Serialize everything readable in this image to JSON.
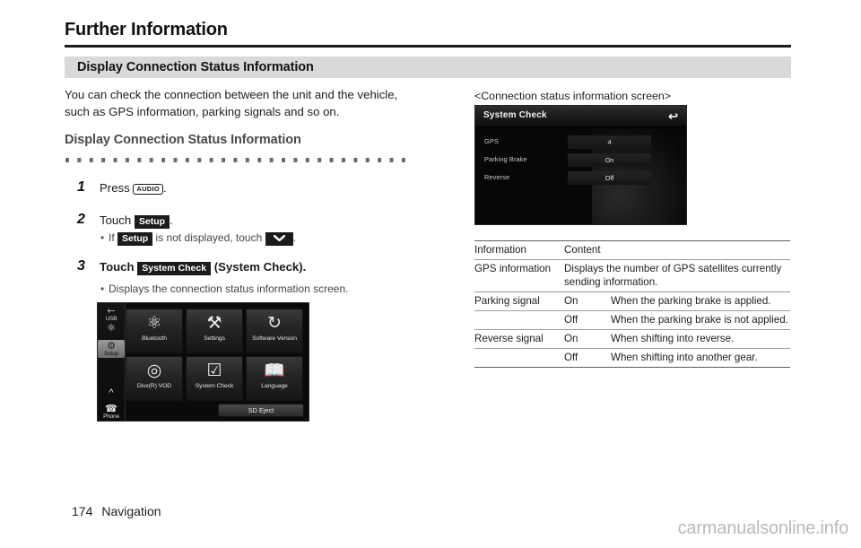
{
  "page": {
    "title": "Further Information",
    "section_band": "Display Connection Status Information",
    "footer_page_number": "174",
    "footer_section": "Navigation",
    "watermark": "carmanualsonline.info"
  },
  "left": {
    "intro": "You can check the connection between the unit and the vehicle, such as GPS information, parking signals and so on.",
    "subsection_title": "Display Connection Status Information",
    "steps": [
      {
        "number": "1",
        "prefix": "Press ",
        "chip": "AUDIO",
        "chip_type": "key",
        "suffix": ".",
        "substeps": []
      },
      {
        "number": "2",
        "prefix": "Touch ",
        "chip": "Setup",
        "chip_type": "touch",
        "suffix": ".",
        "substeps": [
          {
            "pre": "If ",
            "chip": "Setup",
            "mid": " is not displayed, touch ",
            "chip2": "⌄",
            "post": "."
          }
        ]
      },
      {
        "number": "3",
        "prefix": "Touch ",
        "chip": "System Check",
        "chip_type": "touch",
        "suffix": " (System Check).",
        "substeps": [
          {
            "pre": "Displays the connection status information screen.",
            "chip": "",
            "mid": "",
            "chip2": "",
            "post": ""
          }
        ]
      }
    ]
  },
  "device_screen": {
    "sidebar": [
      {
        "icon": "usb-icon",
        "glyph": "⌁",
        "label": "USB"
      },
      {
        "icon": "bluetooth-icon",
        "glyph": "Ƀ",
        "label": ""
      },
      {
        "icon": "setup-gear-icon",
        "glyph": "⚙",
        "label": "Setup"
      },
      {
        "icon": "chevron-up-icon",
        "glyph": "⌃",
        "label": ""
      },
      {
        "icon": "phone-icon",
        "glyph": "☎",
        "label": "Phone"
      }
    ],
    "tiles": [
      {
        "icon": "bluetooth-icon",
        "glyph": "Ƀ",
        "label": "Bluetooth"
      },
      {
        "icon": "settings-gear-wrench-icon",
        "glyph": "⚒",
        "label": "Settings"
      },
      {
        "icon": "refresh-circular-arrow-icon",
        "glyph": "↻",
        "label": "Software Version"
      },
      {
        "icon": "disc-icon",
        "glyph": "◎",
        "label": "Divx(R) VOD"
      },
      {
        "icon": "checklist-clipboard-icon",
        "glyph": "☑",
        "label": "System Check"
      },
      {
        "icon": "open-book-icon",
        "glyph": "☷",
        "label": "Language"
      }
    ],
    "sd_eject_label": "SD Eject"
  },
  "right": {
    "caption": "<Connection status information screen>",
    "system_check_screen": {
      "header_title": "System Check",
      "back_icon": "back-arrow-icon",
      "rows": [
        {
          "label": "GPS",
          "value": "4"
        },
        {
          "label": "Parking Brake",
          "value": "On"
        },
        {
          "label": "Reverse",
          "value": "Off"
        }
      ]
    },
    "table": {
      "headers": [
        "Information",
        "Content"
      ],
      "rows": [
        {
          "information": "GPS information",
          "state": "",
          "content": "Displays the number of GPS satellites currently sending information.",
          "span": true
        },
        {
          "information": "Parking signal",
          "state": "On",
          "content": "When the parking brake is applied.",
          "span": false
        },
        {
          "information": "",
          "state": "Off",
          "content": "When the parking brake is not applied.",
          "span": false
        },
        {
          "information": "Reverse signal",
          "state": "On",
          "content": "When shifting into reverse.",
          "span": false
        },
        {
          "information": "",
          "state": "Off",
          "content": "When shifting into another gear.",
          "span": false
        }
      ]
    }
  }
}
